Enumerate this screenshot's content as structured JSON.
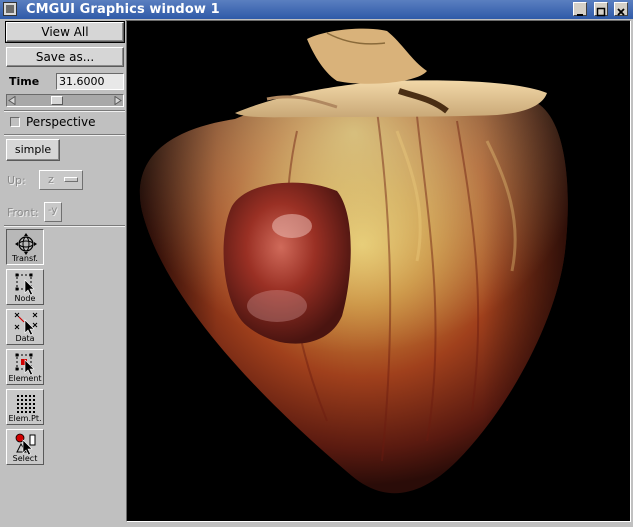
{
  "window": {
    "title": "CMGUI Graphics window 1"
  },
  "panel": {
    "view_all_label": "View All",
    "save_as_label": "Save as...",
    "time_label": "Time",
    "time_value": "31.6000",
    "time_slider_fraction": 0.4,
    "perspective_label": "Perspective",
    "perspective_checked": false,
    "layout_button_label": "simple",
    "up_label": "Up:",
    "up_value": "z",
    "front_label": "Front:",
    "front_value": "-y"
  },
  "tools": [
    {
      "label": "Transf.",
      "icon": "transform-icon",
      "active": true
    },
    {
      "label": "Node",
      "icon": "node-icon",
      "active": false
    },
    {
      "label": "Data",
      "icon": "data-icon",
      "active": false
    },
    {
      "label": "Element",
      "icon": "element-icon",
      "active": false
    },
    {
      "label": "Elem.Pt.",
      "icon": "element-point-icon",
      "active": false
    },
    {
      "label": "Select",
      "icon": "select-icon",
      "active": false
    }
  ],
  "colors": {
    "titlebar": "#3d66b0",
    "panel": "#c0c0c0",
    "viewport_background": "#000000"
  }
}
